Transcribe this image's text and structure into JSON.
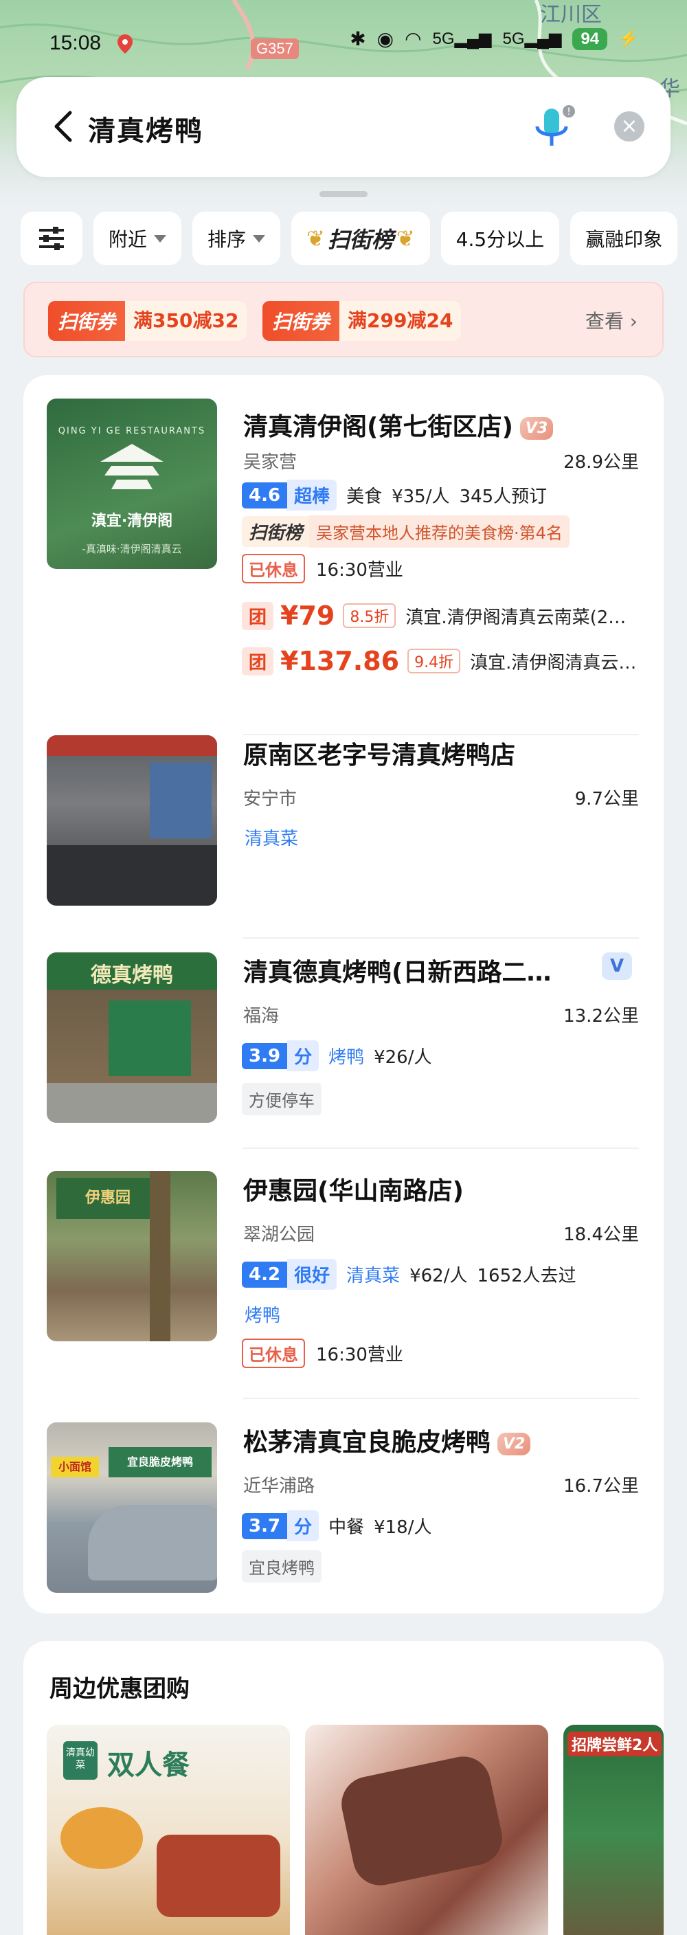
{
  "status_bar": {
    "time": "15:08",
    "network": "5G",
    "battery": "94"
  },
  "map": {
    "district": "江川区",
    "road": "G357",
    "corner": "华"
  },
  "search": {
    "query": "清真烤鸭"
  },
  "filters": [
    {
      "label": "附近"
    },
    {
      "label": "排序"
    },
    {
      "label": "扫街榜"
    },
    {
      "label": "4.5分以上"
    },
    {
      "label": "赢融印象"
    }
  ],
  "coupon_bar": {
    "brand": "扫街券",
    "coupons": [
      {
        "amount": "满350减32"
      },
      {
        "amount": "满299减24"
      }
    ],
    "more": "查看"
  },
  "results": [
    {
      "name": "清真清伊阁(第七街区店)",
      "level": "V3",
      "area": "吴家营",
      "distance": "28.9公里",
      "score": "4.6",
      "rating_word": "超棒",
      "category": "美食",
      "price": "¥35/人",
      "extra": "345人预订",
      "rank_brand": "扫街榜",
      "rank_text": "吴家营本地人推荐的美食榜·第4名",
      "promo_badge": "已休息",
      "promo_time": "16:30营业",
      "deals": [
        {
          "tag": "团",
          "price": "¥79",
          "discount": "8.5折",
          "text": "滇宜.清伊阁清真云南菜(2…"
        },
        {
          "tag": "团",
          "price": "¥137.86",
          "discount": "9.4折",
          "text": "滇宜.清伊阁清真云…"
        }
      ],
      "thumb_text": "滇宜·清伊阁",
      "thumb_sub": "QING YI GE RESTAURANTS",
      "thumb_foot": "-真滇味·清伊阁清真云"
    },
    {
      "name": "原南区老字号清真烤鸭店",
      "area": "安宁市",
      "distance": "9.7公里",
      "tag": "清真菜"
    },
    {
      "name": "清真德真烤鸭(日新西路二…",
      "level": "V",
      "area": "福海",
      "distance": "13.2公里",
      "score": "3.9",
      "rating_word": "分",
      "category": "烤鸭",
      "price": "¥26/人",
      "gray_tag": "方便停车",
      "thumb_text": "德真烤鸭"
    },
    {
      "name": "伊惠园(华山南路店)",
      "area": "翠湖公园",
      "distance": "18.4公里",
      "score": "4.2",
      "rating_word": "很好",
      "category": "清真菜",
      "price": "¥62/人",
      "extra": "1652人去过",
      "tag": "烤鸭",
      "promo_badge": "已休息",
      "promo_time": "16:30营业",
      "thumb_text": "伊惠园"
    },
    {
      "name": "松茅清真宜良脆皮烤鸭",
      "level": "V2",
      "area": "近华浦路",
      "distance": "16.7公里",
      "score": "3.7",
      "rating_word": "分",
      "category": "中餐",
      "price": "¥18/人",
      "tag": "宜良烤鸭",
      "thumb_text": "宜良脆皮烤鸭",
      "thumb_sign": "小面馆"
    }
  ],
  "group_buy": {
    "title": "周边优惠团购",
    "cards": [
      {
        "badge": "清真幼菜",
        "label": "双人餐"
      },
      {
        "label": ""
      },
      {
        "label": "招牌尝鲜2人"
      }
    ]
  },
  "colors": {
    "accent": "#2e7bf4",
    "red": "#e5421e",
    "map_green": "#9fd1a6"
  }
}
